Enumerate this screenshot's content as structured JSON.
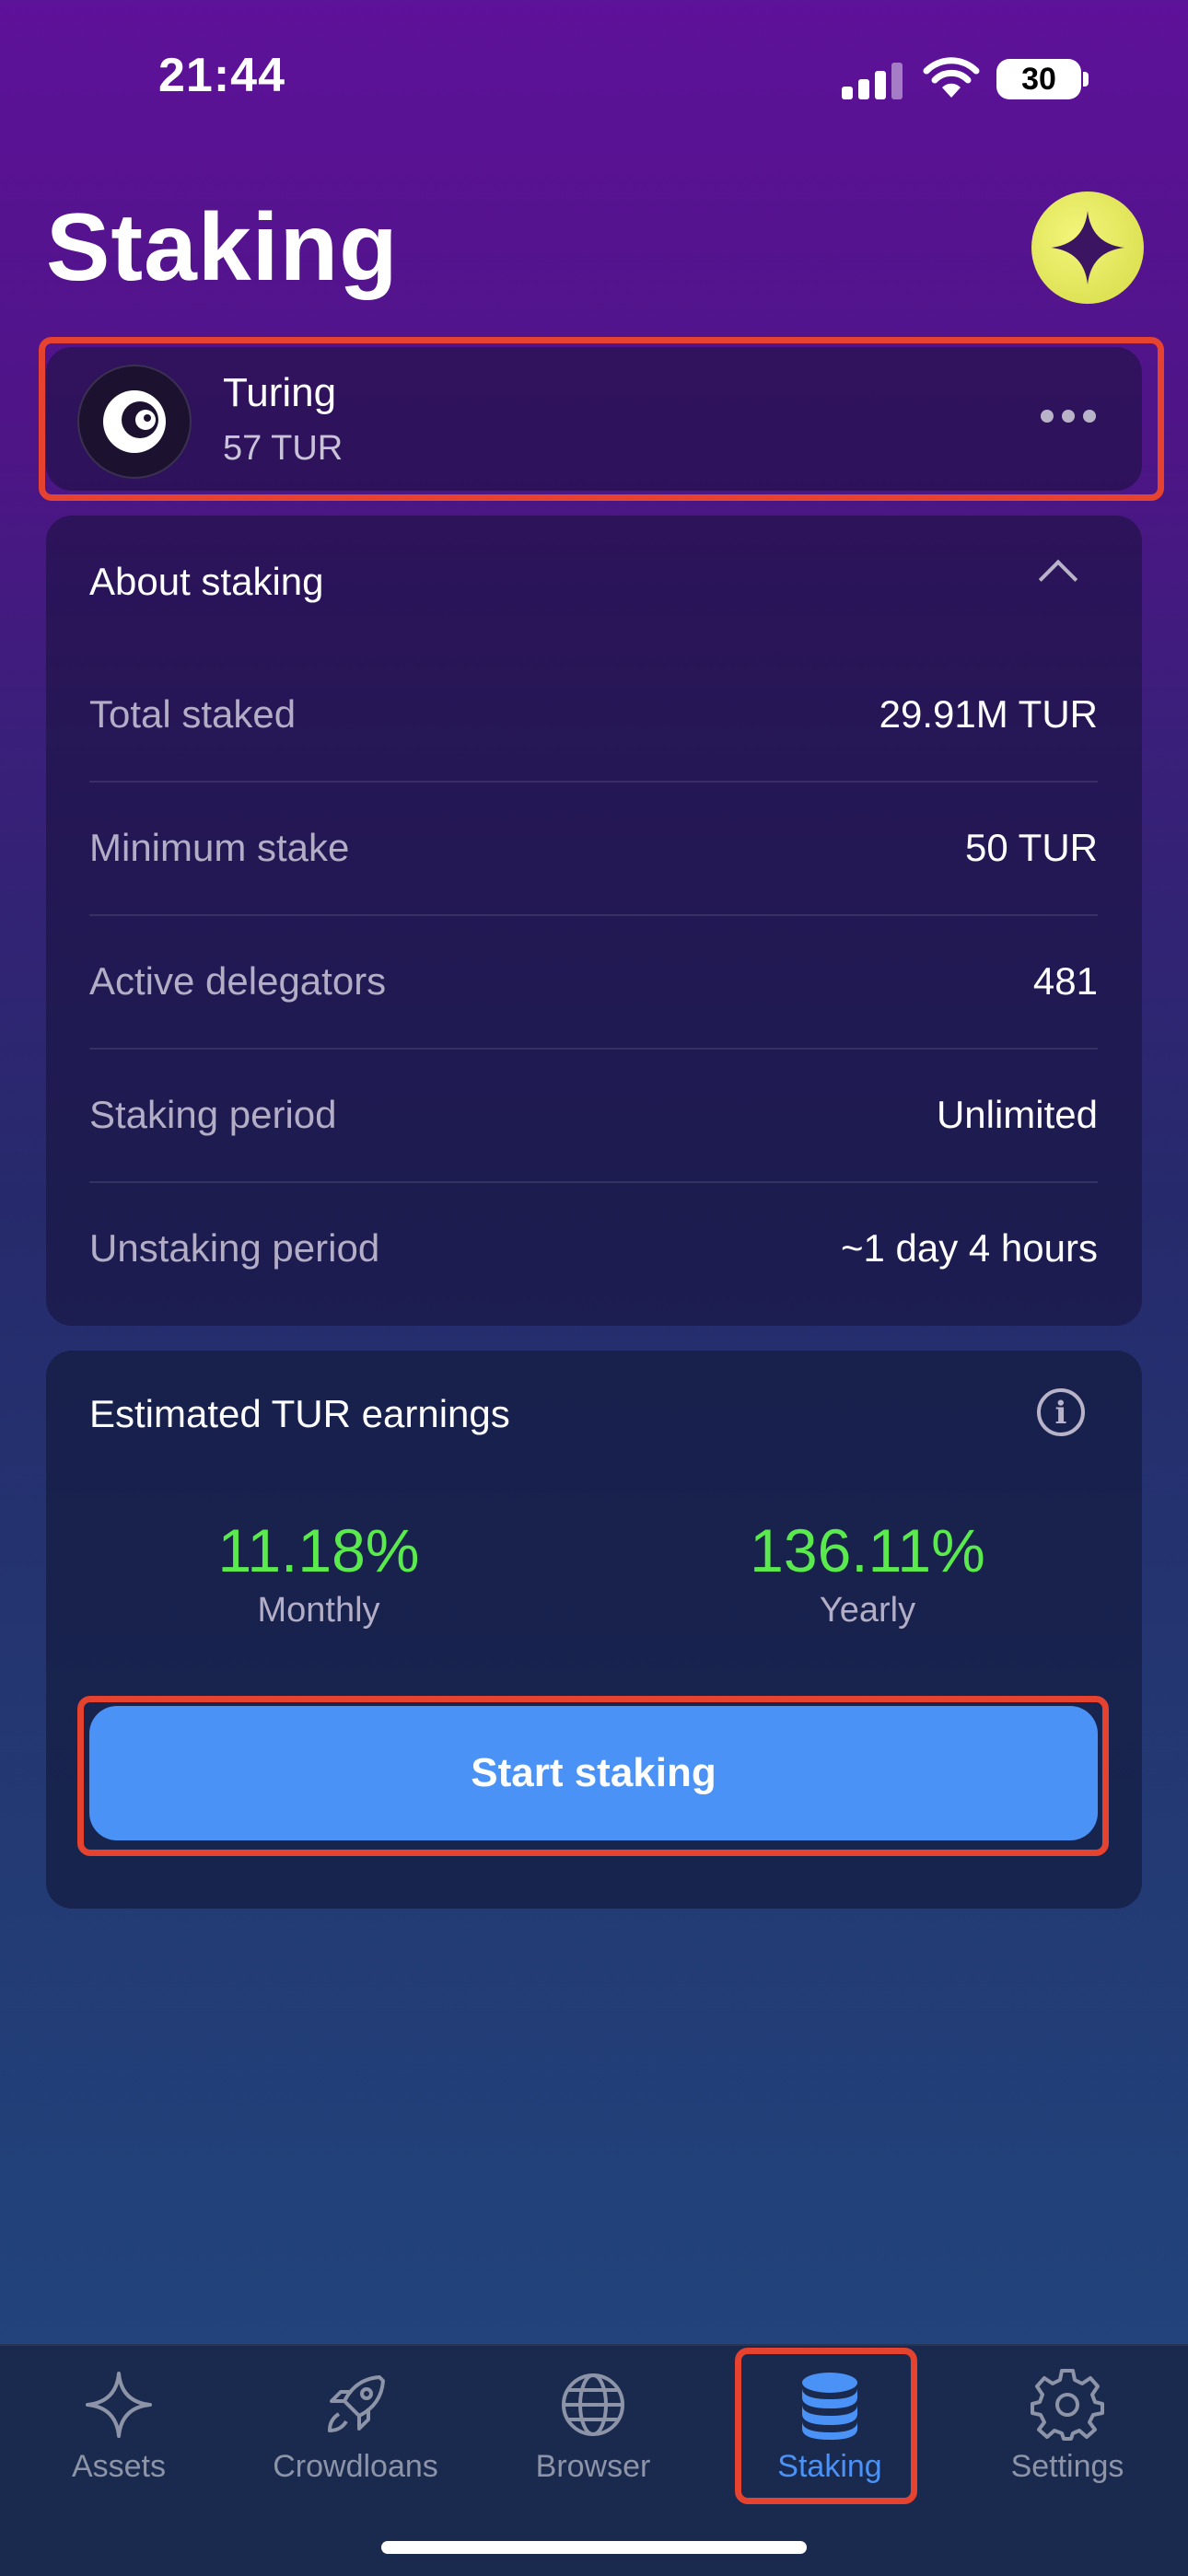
{
  "status_bar": {
    "time": "21:44",
    "battery": "30"
  },
  "header": {
    "title": "Staking"
  },
  "account": {
    "name": "Turing",
    "balance": "57 TUR"
  },
  "about": {
    "title": "About staking",
    "rows": [
      {
        "label": "Total staked",
        "value": "29.91M TUR"
      },
      {
        "label": "Minimum stake",
        "value": "50 TUR"
      },
      {
        "label": "Active delegators",
        "value": "481"
      },
      {
        "label": "Staking period",
        "value": "Unlimited"
      },
      {
        "label": "Unstaking period",
        "value": "~1 day 4 hours"
      }
    ]
  },
  "earnings": {
    "title": "Estimated TUR earnings",
    "monthly_value": "11.18%",
    "monthly_label": "Monthly",
    "yearly_value": "136.11%",
    "yearly_label": "Yearly",
    "positive_color": "#5bea4e"
  },
  "start_button": {
    "label": "Start staking",
    "color": "#4a92f6"
  },
  "tabs": [
    {
      "label": "Assets",
      "icon": "sparkle-icon"
    },
    {
      "label": "Crowdloans",
      "icon": "rocket-icon"
    },
    {
      "label": "Browser",
      "icon": "globe-icon"
    },
    {
      "label": "Staking",
      "icon": "coin-stack-icon",
      "active": true
    },
    {
      "label": "Settings",
      "icon": "gear-icon"
    }
  ]
}
